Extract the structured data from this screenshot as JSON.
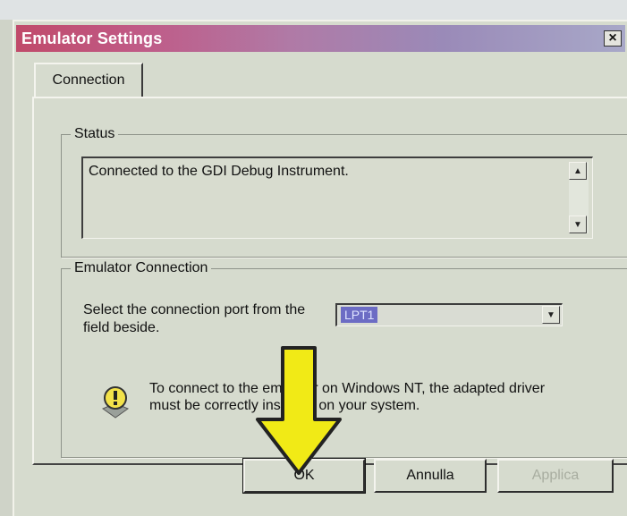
{
  "window": {
    "title": "Emulator Settings",
    "close_glyph": "×"
  },
  "tabs": [
    {
      "label": "Connection"
    }
  ],
  "status_group": {
    "label": "Status",
    "text": "Connected to the GDI Debug Instrument."
  },
  "emulator_group": {
    "label": "Emulator Connection",
    "port_label": "Select the connection port from the field beside.",
    "port_value": "LPT1",
    "info_text": "To connect to the emulator on Windows NT, the adapted driver must be correctly installed on your system."
  },
  "buttons": {
    "ok": "OK",
    "cancel": "Annulla",
    "apply": "Applica"
  },
  "colors": {
    "arrow": "#f1ea16",
    "titlebar_start": "#c04a6a",
    "titlebar_end": "#a8a8c8",
    "selection": "#6c6cc4"
  },
  "icons": {
    "info": "info-warning-icon",
    "close": "close-icon",
    "arrow": "yellow-down-arrow"
  }
}
